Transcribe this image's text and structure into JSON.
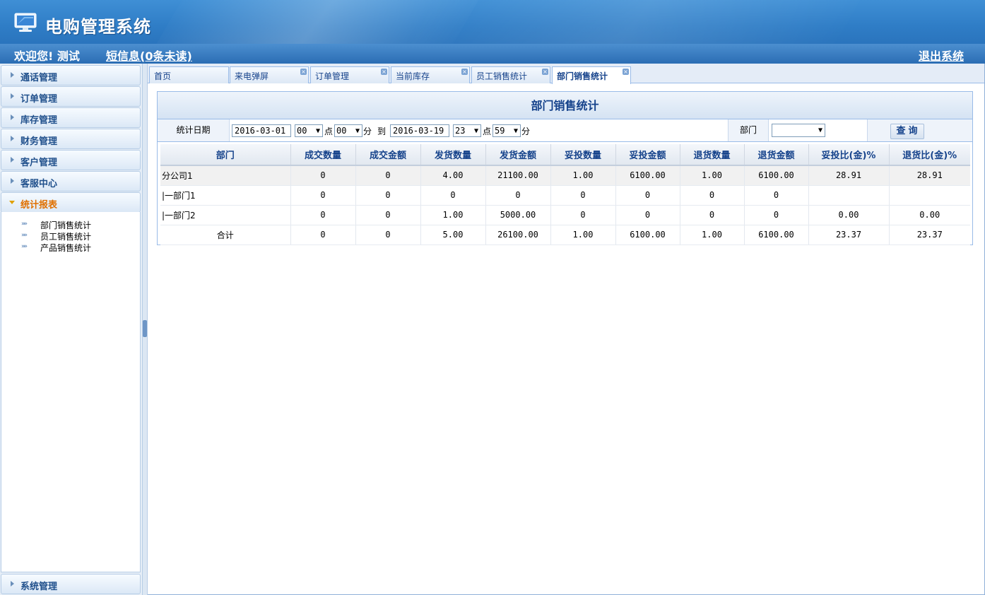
{
  "app": {
    "title": "电购管理系统"
  },
  "infobar": {
    "welcome": "欢迎您! 测试",
    "messages": "短信息(0条未读)",
    "logout": "退出系统"
  },
  "sidebar": {
    "menus": [
      {
        "label": "通话管理"
      },
      {
        "label": "订单管理"
      },
      {
        "label": "库存管理"
      },
      {
        "label": "财务管理"
      },
      {
        "label": "客户管理"
      },
      {
        "label": "客服中心"
      },
      {
        "label": "统计报表"
      }
    ],
    "submenu": [
      {
        "label": "部门销售统计"
      },
      {
        "label": "员工销售统计"
      },
      {
        "label": "产品销售统计"
      }
    ],
    "bottom_menu": {
      "label": "系统管理"
    }
  },
  "tabs": [
    {
      "label": "首页"
    },
    {
      "label": "来电弹屏"
    },
    {
      "label": "订单管理"
    },
    {
      "label": "当前库存"
    },
    {
      "label": "员工销售统计"
    },
    {
      "label": "部门销售统计"
    }
  ],
  "panel": {
    "title": "部门销售统计",
    "filter": {
      "date_label": "统计日期",
      "start_date": "2016-03-01",
      "start_hour": "00",
      "hour_unit": "点",
      "start_min": "00",
      "min_unit": "分",
      "to": "到",
      "end_date": "2016-03-19",
      "end_hour": "23",
      "end_min": "59",
      "dept_label": "部门",
      "dept_value": "",
      "query_button": "查询"
    },
    "table": {
      "headers": [
        "部门",
        "成交数量",
        "成交金额",
        "发货数量",
        "发货金额",
        "妥投数量",
        "妥投金额",
        "退货数量",
        "退货金额",
        "妥投比(金)%",
        "退货比(金)%"
      ],
      "rows": [
        [
          "分公司1",
          "0",
          "0",
          "4.00",
          "21100.00",
          "1.00",
          "6100.00",
          "1.00",
          "6100.00",
          "28.91",
          "28.91"
        ],
        [
          "|一部门1",
          "0",
          "0",
          "0",
          "0",
          "0",
          "0",
          "0",
          "0",
          "",
          ""
        ],
        [
          "|一部门2",
          "0",
          "0",
          "1.00",
          "5000.00",
          "0",
          "0",
          "0",
          "0",
          "0.00",
          "0.00"
        ],
        [
          "合计",
          "0",
          "0",
          "5.00",
          "26100.00",
          "1.00",
          "6100.00",
          "1.00",
          "6100.00",
          "23.37",
          "23.37"
        ]
      ]
    }
  },
  "colors": {
    "header_blue": "#2f7dc6",
    "accent_orange": "#e07000",
    "title_blue": "#15428b"
  },
  "icons": {
    "logo": "monitor-icon",
    "tab_close": "close-icon",
    "submenu": "double-chevron-icon"
  }
}
